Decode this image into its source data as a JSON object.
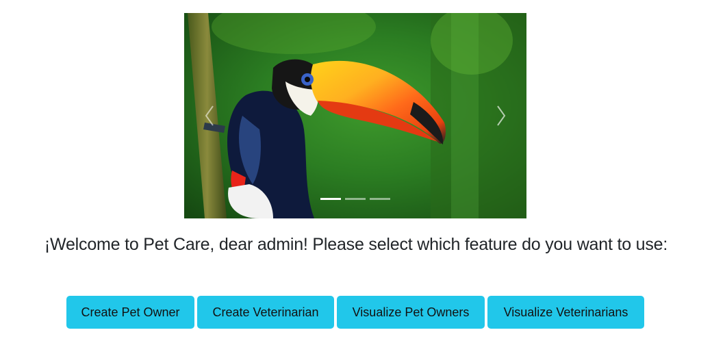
{
  "carousel": {
    "slide_image": "toucan-photo",
    "prev_icon": "chevron-left-icon",
    "next_icon": "chevron-right-icon",
    "slide_count": 3,
    "active_slide_index": 0
  },
  "welcome_text": "¡Welcome to Pet Care, dear admin! Please select which feature do you want to use:",
  "buttons": [
    {
      "label": "Create Pet Owner"
    },
    {
      "label": "Create Veterinarian"
    },
    {
      "label": "Visualize Pet Owners"
    },
    {
      "label": "Visualize Veterinarians"
    }
  ],
  "colors": {
    "button_bg": "#21c7ea",
    "text": "#212529"
  }
}
